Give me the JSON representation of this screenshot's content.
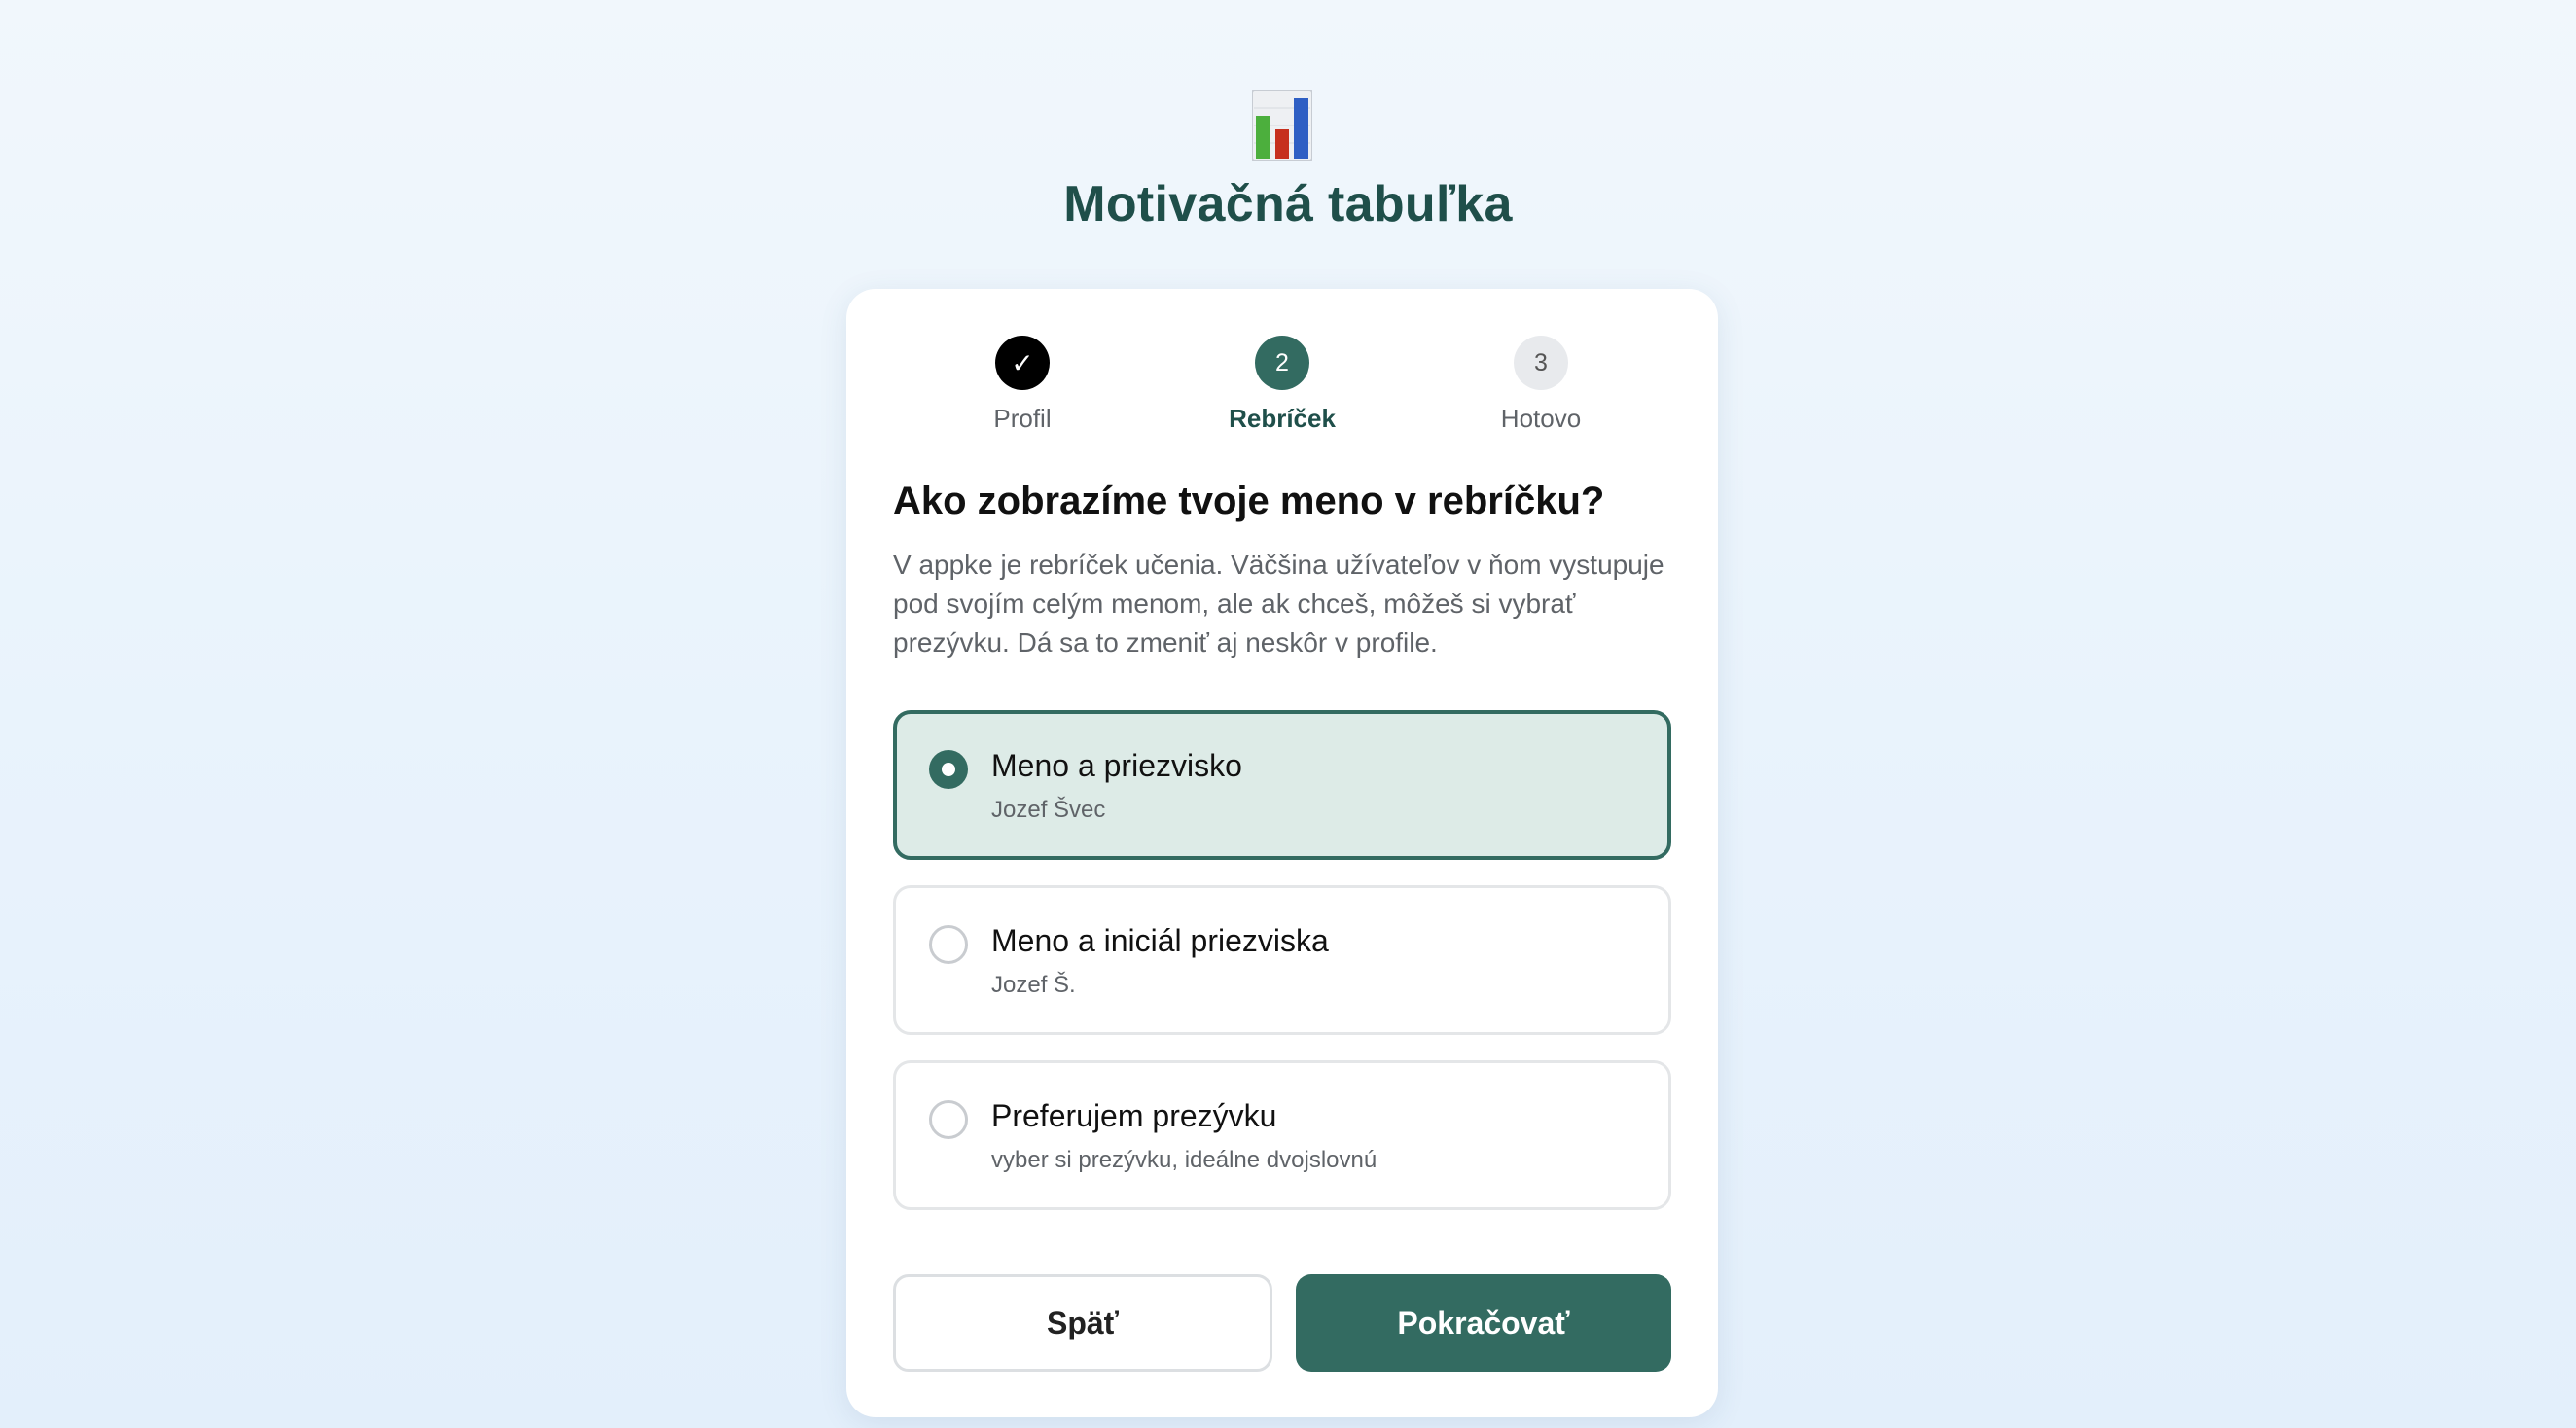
{
  "app": {
    "title": "Motivačná tabuľka",
    "logo_icon": "bar-chart-icon"
  },
  "steps": [
    {
      "marker": "✓",
      "label": "Profil",
      "state": "done"
    },
    {
      "marker": "2",
      "label": "Rebríček",
      "state": "active"
    },
    {
      "marker": "3",
      "label": "Hotovo",
      "state": "pending"
    }
  ],
  "question": {
    "title": "Ako zobrazíme tvoje meno v rebríčku?",
    "description": "V appke je rebríček učenia. Väčšina užívateľov v ňom vystupuje pod svojím celým menom, ale ak chceš, môžeš si vybrať prezývku. Dá sa to zmeniť aj neskôr v profile."
  },
  "options": [
    {
      "title": "Meno a priezvisko",
      "subtitle": "Jozef Švec",
      "selected": true
    },
    {
      "title": "Meno a iniciál priezviska",
      "subtitle": "Jozef Š.",
      "selected": false
    },
    {
      "title": "Preferujem prezývku",
      "subtitle": "vyber si prezývku, ideálne dvojslovnú",
      "selected": false
    }
  ],
  "buttons": {
    "back_label": "Späť",
    "next_label": "Pokračovať"
  },
  "colors": {
    "accent": "#336b61",
    "accent_light": "#ddebe7",
    "title": "#1f4f4a"
  }
}
